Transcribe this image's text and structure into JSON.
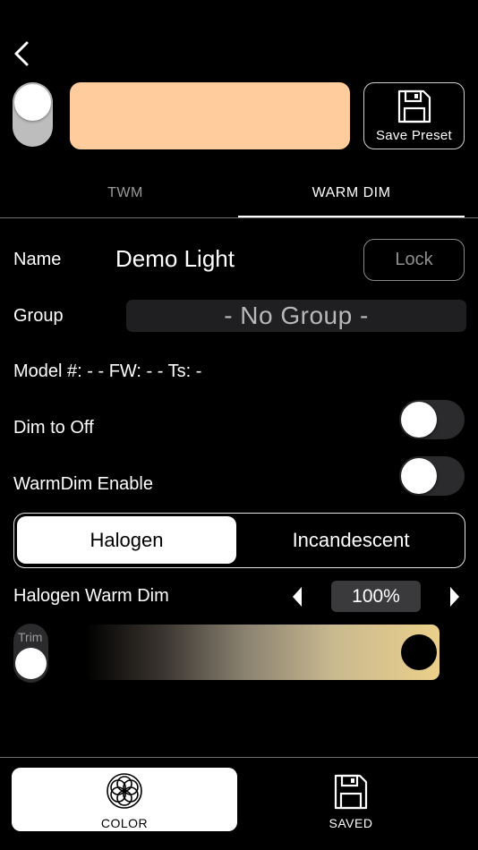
{
  "header": {
    "back_icon": "chevron-left-icon",
    "power_on": true,
    "swatch_color": "#ffcc9e",
    "save_preset_label": "Save Preset",
    "save_preset_icon": "floppy-disk-icon"
  },
  "tabs": [
    {
      "label": "TWM",
      "active": false
    },
    {
      "label": "WARM DIM",
      "active": true
    }
  ],
  "name": {
    "label": "Name",
    "value": "Demo Light",
    "lock_label": "Lock"
  },
  "group": {
    "label": "Group",
    "value": "- No Group -"
  },
  "info": {
    "text": "Model #: - - FW: - - Ts: -"
  },
  "dim_to_off": {
    "label": "Dim to Off",
    "on": false
  },
  "warmdim_enable": {
    "label": "WarmDim Enable",
    "on": false
  },
  "mode": {
    "options": [
      "Halogen",
      "Incandescent"
    ],
    "selected": "Halogen"
  },
  "warm_dim": {
    "label": "Halogen Warm Dim",
    "value": "100%",
    "level": 1.0,
    "left_icon": "triangle-left-icon",
    "right_icon": "triangle-right-icon"
  },
  "trim": {
    "label": "Trim",
    "on": false
  },
  "bottom_nav": [
    {
      "label": "COLOR",
      "icon": "flower-of-life-icon",
      "active": true
    },
    {
      "label": "SAVED",
      "icon": "floppy-disk-icon",
      "active": false
    }
  ]
}
